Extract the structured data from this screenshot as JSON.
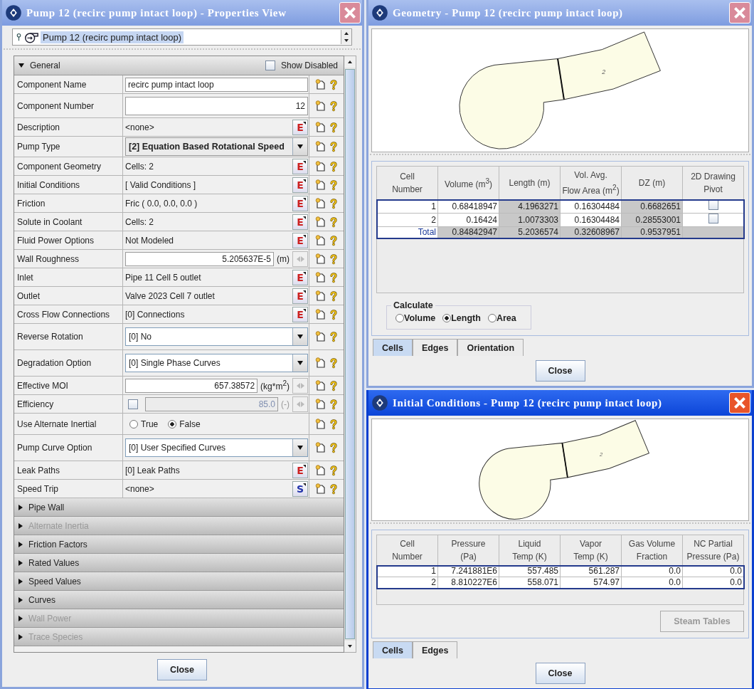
{
  "properties_window": {
    "title": "Pump 12 (recirc pump intact loop) - Properties View",
    "active": false,
    "selector": {
      "value": "Pump 12 (recirc pump intact loop)"
    },
    "general": {
      "label": "General",
      "expanded": true,
      "show_disabled": {
        "label": "Show Disabled",
        "checked": false
      },
      "rows": [
        {
          "label": "Component Name",
          "kind": "text",
          "value": "recirc pump intact loop"
        },
        {
          "label": "Component Number",
          "kind": "number",
          "value": "12"
        },
        {
          "label": "Description",
          "kind": "editor",
          "value": "<none>",
          "button": "E",
          "color": "#cc2222"
        },
        {
          "label": "Pump Type",
          "kind": "dropdown",
          "value": "[2] Equation Based Rotational Speed",
          "bold": true
        },
        {
          "label": "Component Geometry",
          "kind": "editor",
          "value": "Cells: 2",
          "button": "E",
          "color": "#cc2222"
        },
        {
          "label": "Initial Conditions",
          "kind": "editor",
          "value": "[ Valid Conditions ]",
          "button": "E",
          "color": "#cc2222"
        },
        {
          "label": "Friction",
          "kind": "editor",
          "value": "Fric ( 0.0, 0.0, 0.0 )",
          "button": "E",
          "color": "#cc2222"
        },
        {
          "label": "Solute in Coolant",
          "kind": "editor",
          "value": "Cells: 2",
          "button": "E",
          "color": "#cc2222"
        },
        {
          "label": "Fluid Power Options",
          "kind": "editor",
          "value": "Not Modeled",
          "button": "E",
          "color": "#cc2222"
        },
        {
          "label": "Wall Roughness",
          "kind": "unit",
          "value": "5.205637E-5",
          "unit": "(m)"
        },
        {
          "label": "Inlet",
          "kind": "editor",
          "value": "Pipe 11 Cell 5 outlet",
          "button": "E",
          "color": "#cc2222"
        },
        {
          "label": "Outlet",
          "kind": "editor",
          "value": "Valve 2023 Cell 7 outlet",
          "button": "E",
          "color": "#cc2222"
        },
        {
          "label": "Cross Flow Connections",
          "kind": "editor",
          "value": "[0] Connections",
          "button": "E",
          "color": "#cc2222"
        },
        {
          "label": "Reverse Rotation",
          "kind": "dropdown",
          "value": "[0] No",
          "bold": false
        },
        {
          "label": "Degradation Option",
          "kind": "dropdown",
          "value": "[0] Single Phase Curves",
          "bold": false
        },
        {
          "label": "Effective MOI",
          "kind": "unit",
          "value": "657.38572",
          "unit": "(kg*m$^{2}$)"
        },
        {
          "label": "Efficiency",
          "kind": "checkunit",
          "checked": false,
          "value": "85.0",
          "unit": "(-)"
        },
        {
          "label": "Use Alternate Inertial",
          "kind": "radio",
          "options": [
            {
              "label": "True",
              "selected": false
            },
            {
              "label": "False",
              "selected": true
            }
          ]
        },
        {
          "label": "Pump Curve Option",
          "kind": "dropdown",
          "value": "[0] User Specified Curves",
          "bold": false
        },
        {
          "label": "Leak Paths",
          "kind": "editor",
          "value": "[0] Leak Paths",
          "button": "E",
          "color": "#cc2222"
        },
        {
          "label": "Speed Trip",
          "kind": "editor",
          "value": "<none>",
          "button": "S",
          "color": "#2233aa"
        }
      ]
    },
    "sections": [
      {
        "label": "Pipe Wall",
        "expanded": false,
        "enabled": true
      },
      {
        "label": "Alternate Inertia",
        "expanded": false,
        "enabled": false
      },
      {
        "label": "Friction Factors",
        "expanded": false,
        "enabled": true
      },
      {
        "label": "Rated Values",
        "expanded": false,
        "enabled": true
      },
      {
        "label": "Speed Values",
        "expanded": false,
        "enabled": true
      },
      {
        "label": "Curves",
        "expanded": false,
        "enabled": true
      },
      {
        "label": "Wall Power",
        "expanded": false,
        "enabled": false
      },
      {
        "label": "Trace Species",
        "expanded": false,
        "enabled": false
      }
    ],
    "close": "Close"
  },
  "geometry_window": {
    "title": "Geometry - Pump 12 (recirc pump intact loop)",
    "active": false,
    "cell_label": "2",
    "table": {
      "columns": [
        [
          "Cell",
          "Number"
        ],
        [
          "Volume (m$^{3}$)"
        ],
        [
          "Length (m)"
        ],
        [
          "Vol. Avg.",
          "Flow Area (m$^{2}$)"
        ],
        [
          "DZ (m)"
        ],
        [
          "2D Drawing",
          "Pivot"
        ]
      ],
      "rows": [
        {
          "kind": "cell",
          "cell": "1",
          "values": [
            {
              "text": "0.68418947",
              "shaded": false
            },
            {
              "text": "4.1963271",
              "shaded": true
            },
            {
              "text": "0.16304484",
              "shaded": false
            },
            {
              "text": "0.6682651",
              "shaded": true
            }
          ],
          "pivot": {
            "checked": false
          }
        },
        {
          "kind": "cell",
          "cell": "2",
          "values": [
            {
              "text": "0.16424",
              "shaded": false
            },
            {
              "text": "1.0073303",
              "shaded": true
            },
            {
              "text": "0.16304484",
              "shaded": false
            },
            {
              "text": "0.28553001",
              "shaded": true
            }
          ],
          "pivot": {
            "checked": false
          }
        },
        {
          "kind": "total",
          "cell": "Total",
          "values": [
            {
              "text": "0.84842947",
              "shaded": true
            },
            {
              "text": "5.2036574",
              "shaded": true
            },
            {
              "text": "0.32608967",
              "shaded": true
            },
            {
              "text": "0.9537951",
              "shaded": true
            }
          ]
        }
      ]
    },
    "calculate": {
      "label": "Calculate",
      "options": [
        {
          "label": "Volume",
          "selected": false
        },
        {
          "label": "Length",
          "selected": true
        },
        {
          "label": "Area",
          "selected": false
        }
      ]
    },
    "tabs": [
      {
        "label": "Cells",
        "selected": true
      },
      {
        "label": "Edges",
        "selected": false
      },
      {
        "label": "Orientation",
        "selected": false
      }
    ],
    "close": "Close"
  },
  "initial_conditions_window": {
    "title": "Initial Conditions - Pump 12 (recirc pump intact loop)",
    "active": true,
    "cell_label": "2",
    "table": {
      "columns": [
        [
          "Cell",
          "Number"
        ],
        [
          "Pressure",
          "(Pa)"
        ],
        [
          "Liquid",
          "Temp (K)"
        ],
        [
          "Vapor",
          "Temp (K)"
        ],
        [
          "Gas Volume",
          "Fraction"
        ],
        [
          "NC Partial",
          "Pressure (Pa)"
        ]
      ],
      "rows": [
        {
          "cell": "1",
          "values": [
            "7.241881E6",
            "557.485",
            "561.287",
            "0.0",
            "0.0"
          ]
        },
        {
          "cell": "2",
          "values": [
            "8.810227E6",
            "558.071",
            "574.97",
            "0.0",
            "0.0"
          ]
        }
      ]
    },
    "steam_tables": {
      "label": "Steam Tables",
      "disabled": true
    },
    "tabs": [
      {
        "label": "Cells",
        "selected": true
      },
      {
        "label": "Edges",
        "selected": false
      }
    ],
    "close": "Close"
  }
}
